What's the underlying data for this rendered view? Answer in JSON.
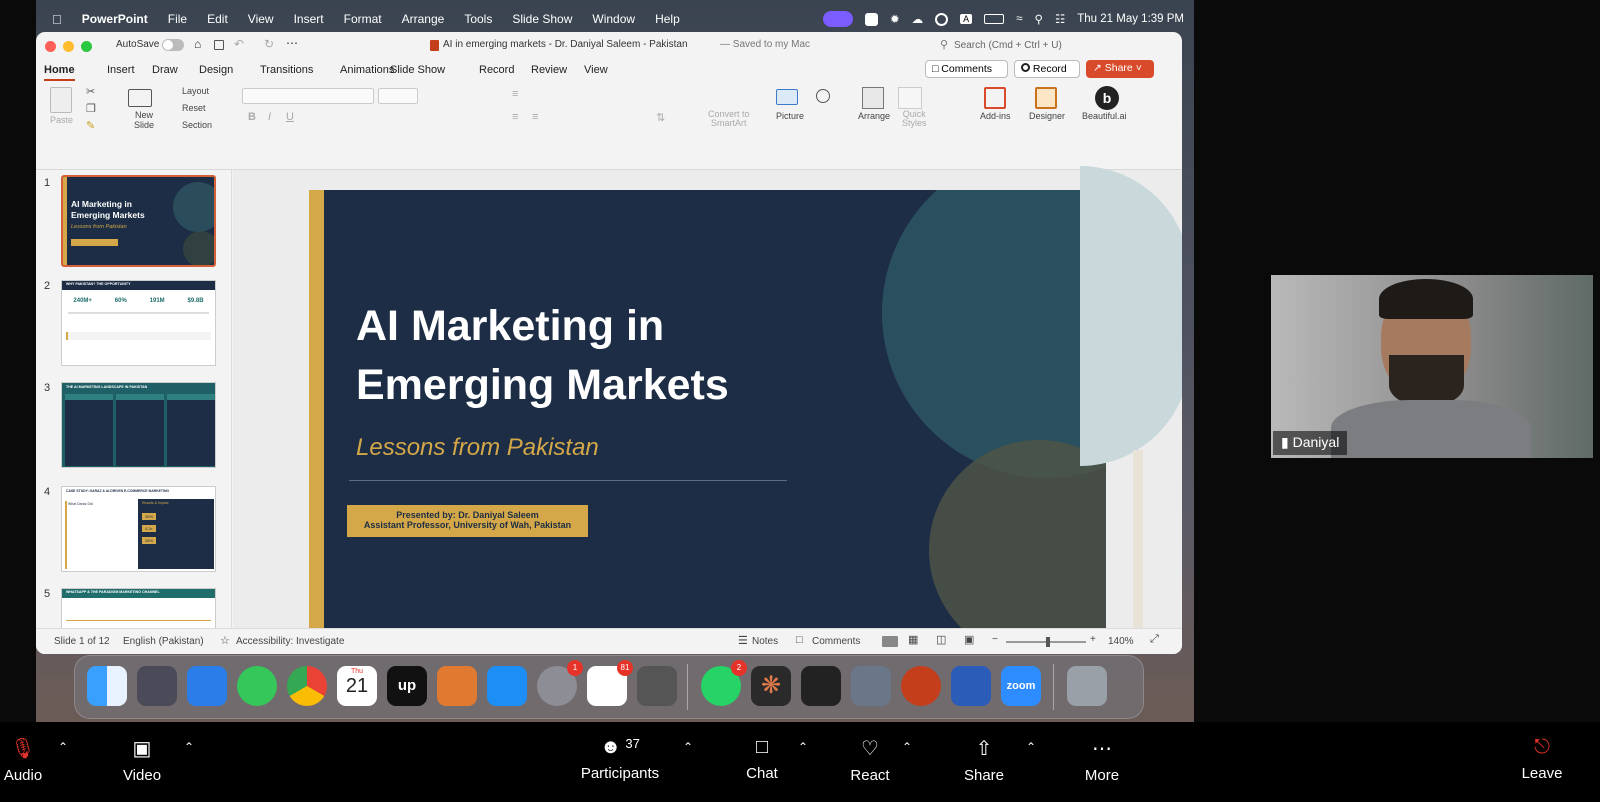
{
  "menubar": {
    "app": "PowerPoint",
    "items": [
      "File",
      "Edit",
      "View",
      "Insert",
      "Format",
      "Arrange",
      "Tools",
      "Slide Show",
      "Window",
      "Help"
    ],
    "datetime": "Thu 21 May  1:39 PM"
  },
  "window": {
    "autosave": "AutoSave",
    "title": "AI in emerging markets - Dr. Daniyal Saleem - Pakistan",
    "saved": "— Saved to my Mac",
    "search_placeholder": "Search (Cmd + Ctrl + U)"
  },
  "tabs": [
    "Home",
    "Insert",
    "Draw",
    "Design",
    "Transitions",
    "Animations",
    "Slide Show",
    "Record",
    "Review",
    "View"
  ],
  "tab_actions": {
    "comments": "Comments",
    "record": "Record",
    "share": "Share"
  },
  "ribbon": {
    "paste": "Paste",
    "new_slide": "New\nSlide",
    "layout": "Layout",
    "reset": "Reset",
    "section": "Section",
    "picture": "Picture",
    "convert": "Convert to\nSmartArt",
    "arrange": "Arrange",
    "quick_styles": "Quick\nStyles",
    "addins": "Add-ins",
    "designer": "Designer",
    "beautiful": "Beautiful.ai"
  },
  "thumbnails": {
    "numbers": [
      "1",
      "2",
      "3",
      "4",
      "5"
    ],
    "t1": {
      "title": "AI Marketing in Emerging Markets",
      "subtitle": "Lessons from Pakistan"
    },
    "t2": {
      "heading": "WHY PAKISTAN? THE OPPORTUNITY",
      "stats": [
        "240M+",
        "60%",
        "191M",
        "$9.8B"
      ]
    },
    "t3": {
      "heading": "THE AI MARKETING LANDSCAPE IN PAKISTAN"
    },
    "t4": {
      "heading": "CASE STUDY: DARAZ & AI-DRIVEN E-COMMERCE MARKETING",
      "left": "What Daraz Did",
      "right": "Results & Impact",
      "vals": [
        "35%",
        "4.2x",
        "28%"
      ]
    },
    "t5": {
      "heading": "WHATSAPP & THE PARADIGM MARKETING CHANNEL"
    }
  },
  "slide": {
    "title1": "AI Marketing in",
    "title2": "Emerging Markets",
    "subtitle": "Lessons from Pakistan",
    "presenter1": "Presented by: Dr. Daniyal Saleem",
    "presenter2": "Assistant Professor, University of Wah, Pakistan"
  },
  "status": {
    "slide": "Slide 1 of 12",
    "language": "English (Pakistan)",
    "accessibility": "Accessibility: Investigate",
    "notes": "Notes",
    "comments": "Comments",
    "zoom": "140%"
  },
  "dock": {
    "calendar_day": "Thu",
    "calendar_date": "21",
    "badges": {
      "settings": "1",
      "reminders": "81",
      "whatsapp": "2"
    },
    "zoom_label": "zoom"
  },
  "camera": {
    "name": "Daniyal"
  },
  "zoom": {
    "audio": "Audio",
    "video": "Video",
    "participants": "Participants",
    "participants_count": "37",
    "chat": "Chat",
    "react": "React",
    "share": "Share",
    "more": "More",
    "leave": "Leave"
  },
  "colors": {
    "slide_bg": "#1c2d45",
    "gold": "#d4a848",
    "share_orange": "#d94a2b",
    "teal": "#1f6e6c"
  }
}
